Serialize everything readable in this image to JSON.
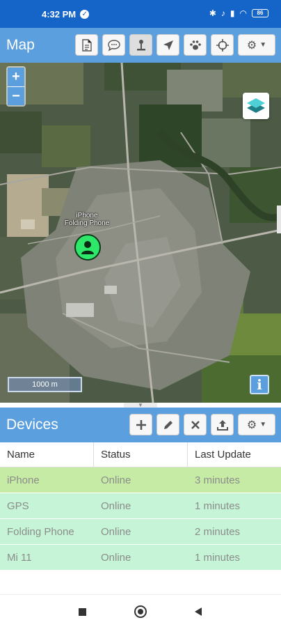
{
  "status_bar": {
    "time": "4:32 PM",
    "battery": "86"
  },
  "map_panel": {
    "title": "Map",
    "toolbar": [
      "report-icon",
      "chat-icon",
      "pin-icon",
      "navigate-icon",
      "paw-icon",
      "crosshair-icon",
      "settings-icon"
    ],
    "zoom_in": "+",
    "zoom_out": "−",
    "scale": "1000 m",
    "info": "i",
    "marker_label_line1": "iPhone",
    "marker_label_line2": "Folding Phone"
  },
  "devices_panel": {
    "title": "Devices",
    "toolbar": [
      "add-icon",
      "edit-icon",
      "remove-icon",
      "upload-icon",
      "settings-icon"
    ],
    "columns": [
      "Name",
      "Status",
      "Last Update"
    ],
    "rows": [
      {
        "name": "iPhone",
        "status": "Online",
        "last_update": "3 minutes",
        "color": "#c6eba4"
      },
      {
        "name": "GPS",
        "status": "Online",
        "last_update": "1 minutes",
        "color": "#c5f5d6"
      },
      {
        "name": "Folding Phone",
        "status": "Online",
        "last_update": "2 minutes",
        "color": "#c5f5d6"
      },
      {
        "name": "Mi 11",
        "status": "Online",
        "last_update": "1 minutes",
        "color": "#c5f5d6"
      }
    ]
  },
  "colors": {
    "header": "#5b9fde",
    "status_bar": "#1565c9",
    "marker": "#2ee86a"
  }
}
